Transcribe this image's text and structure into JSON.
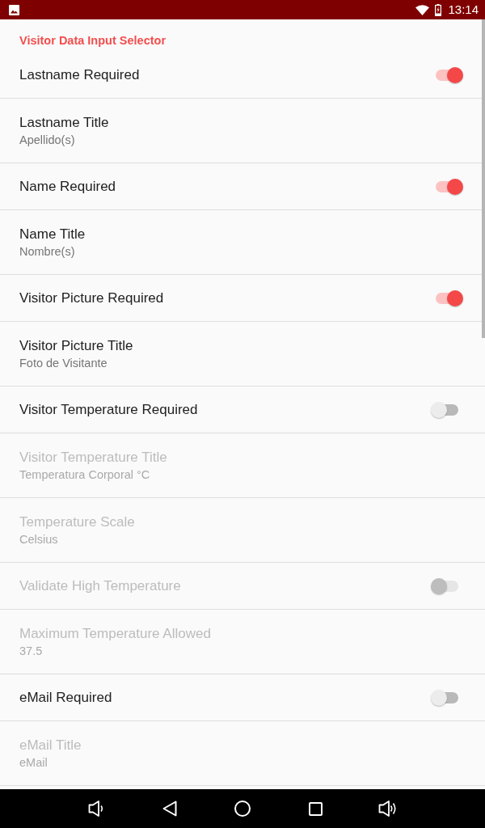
{
  "status_bar": {
    "time": "13:14"
  },
  "category": {
    "title": "Visitor Data Input Selector"
  },
  "preferences": [
    {
      "kind": "switch",
      "title": "Lastname Required",
      "on": true,
      "disabled": false
    },
    {
      "kind": "text",
      "title": "Lastname Title",
      "summary": "Apellido(s)",
      "disabled": false
    },
    {
      "kind": "switch",
      "title": "Name Required",
      "on": true,
      "disabled": false
    },
    {
      "kind": "text",
      "title": "Name Title",
      "summary": "Nombre(s)",
      "disabled": false
    },
    {
      "kind": "switch",
      "title": "Visitor Picture Required",
      "on": true,
      "disabled": false
    },
    {
      "kind": "text",
      "title": "Visitor Picture Title",
      "summary": "Foto de Visitante",
      "disabled": false
    },
    {
      "kind": "switch",
      "title": "Visitor Temperature Required",
      "on": false,
      "disabled": false
    },
    {
      "kind": "text",
      "title": "Visitor Temperature Title",
      "summary": "Temperatura Corporal °C",
      "disabled": true
    },
    {
      "kind": "text",
      "title": "Temperature Scale",
      "summary": "Celsius",
      "disabled": true
    },
    {
      "kind": "switch",
      "title": "Validate High Temperature",
      "on": false,
      "disabled": true
    },
    {
      "kind": "text",
      "title": "Maximum Temperature Allowed",
      "summary": "37.5",
      "disabled": true
    },
    {
      "kind": "switch",
      "title": "eMail Required",
      "on": false,
      "disabled": false
    },
    {
      "kind": "text",
      "title": "eMail Title",
      "summary": "eMail",
      "disabled": true
    }
  ]
}
